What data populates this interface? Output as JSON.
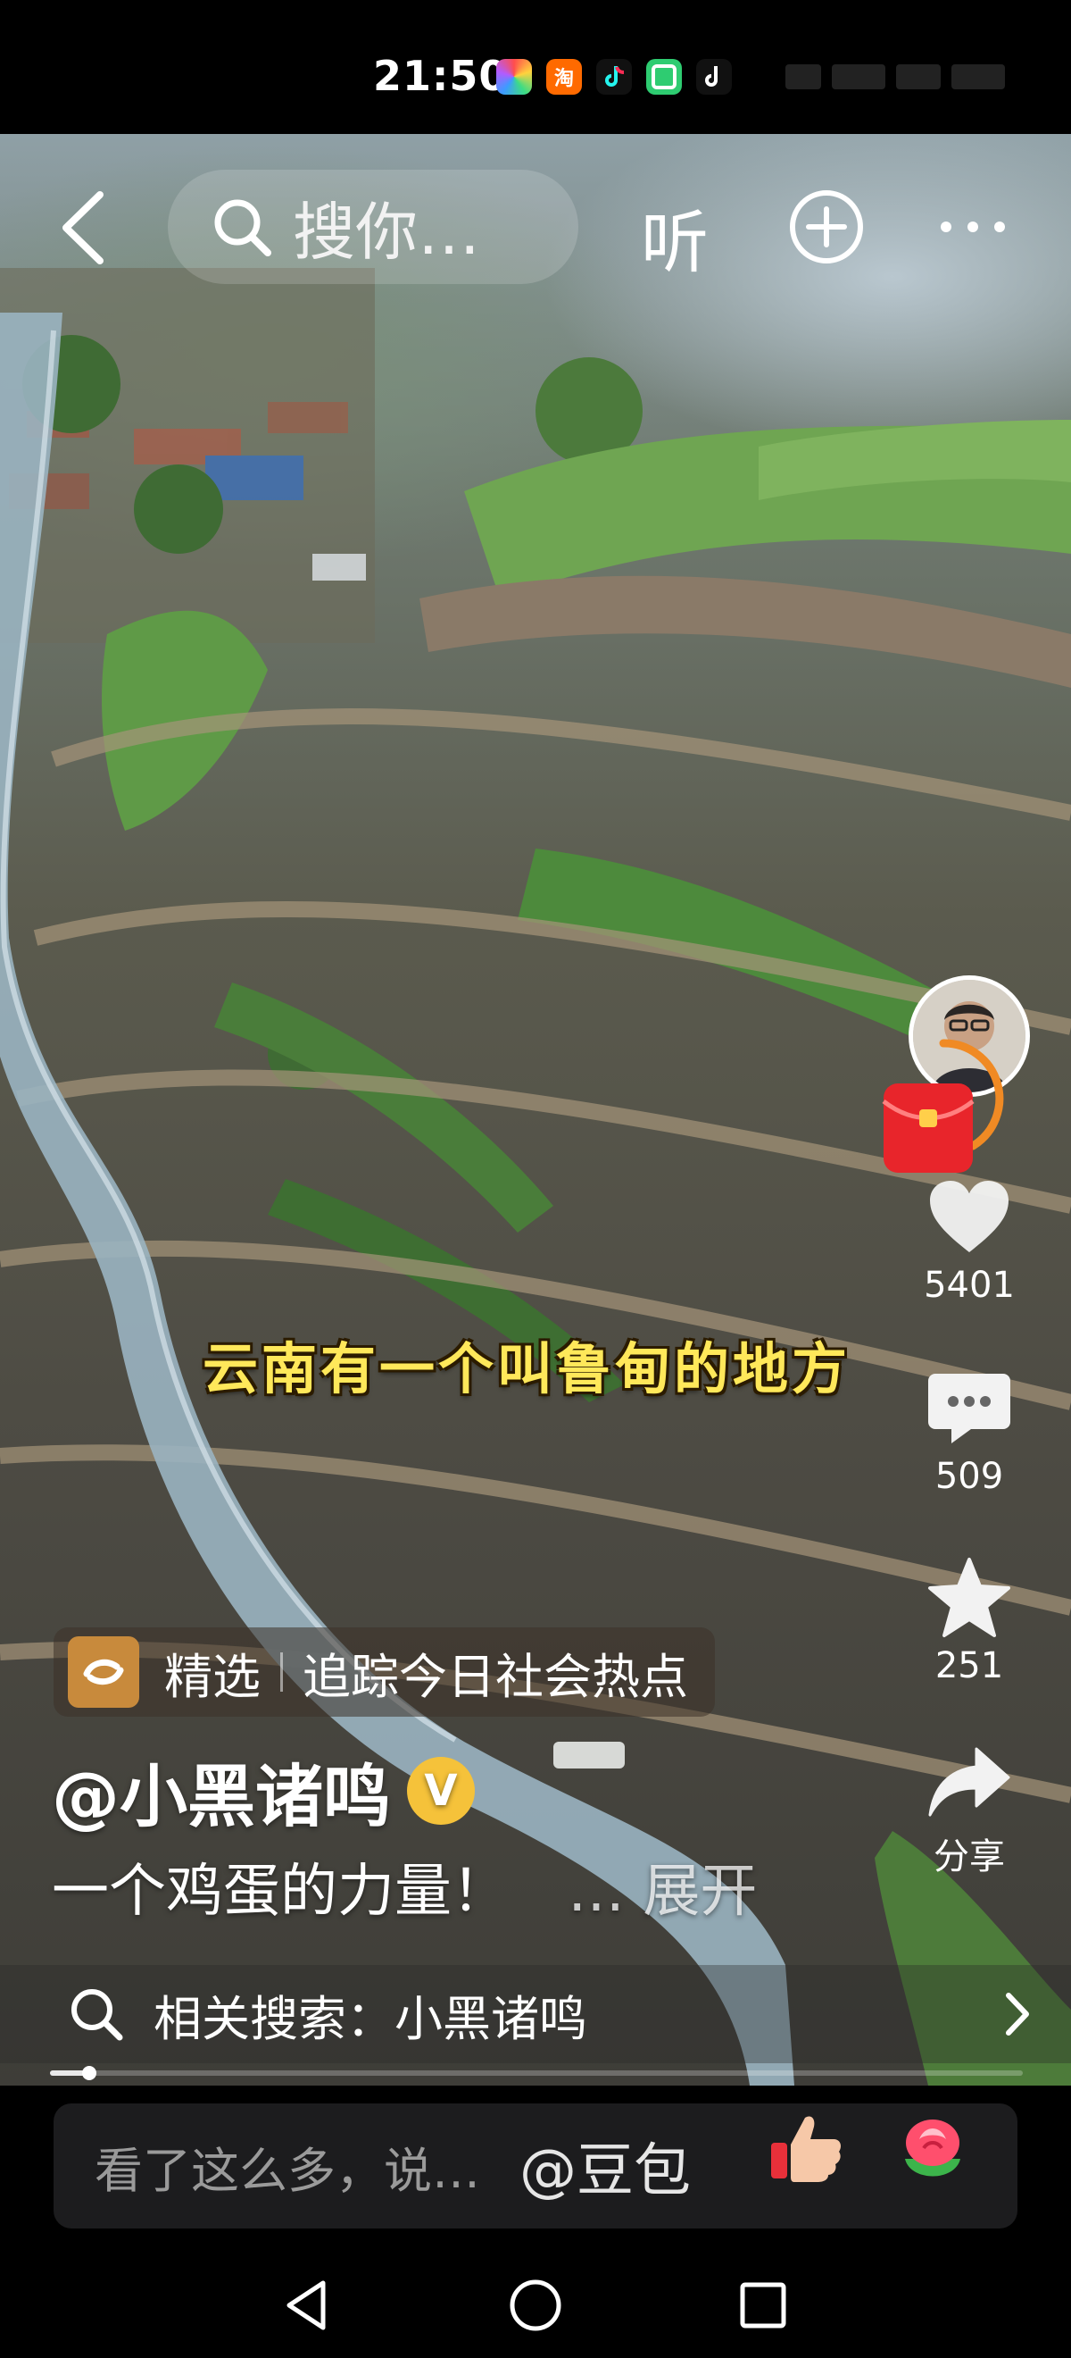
{
  "status_bar": {
    "time": "21:50",
    "apps": [
      {
        "name": "app-colorful-icon",
        "color": "#ffffff"
      },
      {
        "name": "taobao-icon",
        "label": "淘",
        "color": "#ff6a00"
      },
      {
        "name": "tiktok-icon",
        "color": "#000000"
      },
      {
        "name": "green-app-icon",
        "color": "#2ecc71"
      },
      {
        "name": "tiktok-icon",
        "color": "#000000"
      }
    ]
  },
  "top_nav": {
    "search_text": "搜你…",
    "listen_label": "听"
  },
  "video": {
    "caption": "云南有一个叫鲁甸的地方",
    "likes": "5401",
    "comments": "509",
    "favorites": "251",
    "share_label": "分享"
  },
  "info": {
    "tag_title": "精选",
    "tag_desc": "追踪今日社会热点",
    "author": "@小黑诸鸣",
    "verified": "V",
    "description": "一个鸡蛋的力量！",
    "expand_label": "… 展开",
    "related_search": "相关搜索：小黑诸鸣",
    "progress": 0.04
  },
  "comment_bar": {
    "placeholder": "看了这么多，说…",
    "mention": "@豆包"
  },
  "colors": {
    "caption_yellow": "#ffe85a",
    "verified_gold": "#f5c23a",
    "red_packet": "#e8252b",
    "ring_orange": "#f08a24"
  }
}
